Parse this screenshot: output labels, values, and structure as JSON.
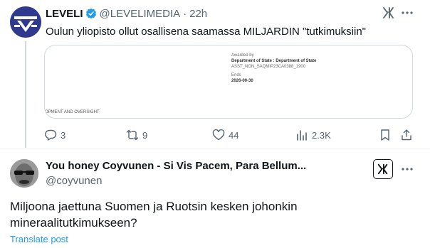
{
  "tweet1": {
    "display_name": "LEVELI",
    "handle": "@LEVELIMEDIA",
    "separator": "·",
    "time": "22h",
    "text": "Oulun yliopisto ollut osallisena saamassa MILJARDIN \"tutkimuksiin\"",
    "card": {
      "awarded_by_label": "Awarded by",
      "awarded_by_value": "Department of State : Department of State",
      "award_code": "ASST_NON_SAQMIP23CA0388_1900",
      "ends_label": "Ends",
      "ends_value": "2026-09-30",
      "footer_text": "OPMENT AND OVERSIGHT"
    },
    "stats": {
      "replies": "3",
      "reposts": "9",
      "likes": "44",
      "views": "2.3K"
    }
  },
  "tweet2": {
    "display_name": "You honey Coyvunen - Si Vis Pacem, Para Bellum...",
    "handle": "@coyvunen",
    "text": "Miljoona jaettuna Suomen ja Ruotsin kesken johonkin mineraalitutkimukseen?",
    "translate_label": "Translate post"
  },
  "colors": {
    "text_primary": "#0f1419",
    "text_secondary": "#536471",
    "link": "#1d9bf0",
    "verified": "#1d9bf0",
    "border": "#cfd9de"
  }
}
